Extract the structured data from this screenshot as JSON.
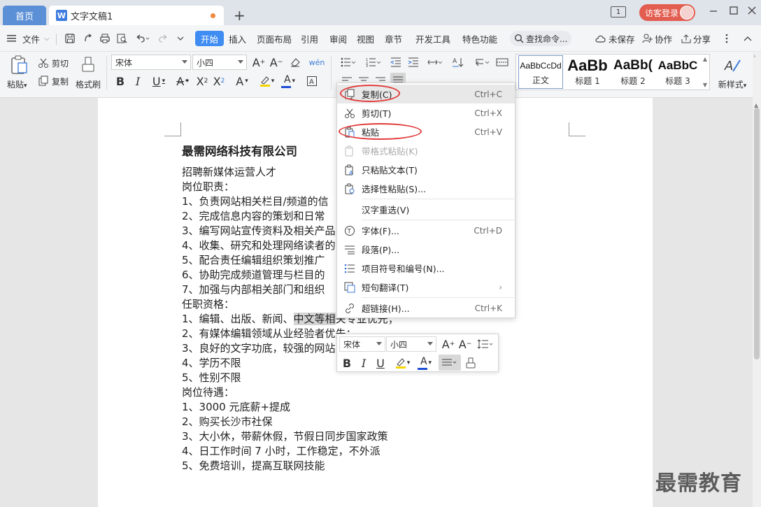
{
  "titlebar": {
    "home_tab": "首页",
    "doc_icon": "W",
    "doc_tab": "文字文稿1",
    "new_tab": "+",
    "window_count": "1",
    "guest_login": "访客登录"
  },
  "menubar": {
    "file": "文件",
    "items": [
      "开始",
      "插入",
      "页面布局",
      "引用",
      "审阅",
      "视图",
      "章节",
      "开发工具",
      "特色功能"
    ],
    "search_placeholder": "查找命令...",
    "unsaved": "未保存",
    "collab": "协作",
    "share": "分享"
  },
  "ribbon": {
    "paste": "粘贴",
    "cut": "剪切",
    "copy": "复制",
    "format_painter": "格式刷",
    "font_name": "宋体",
    "font_size": "小四",
    "styles": [
      {
        "sample": "AaBbCcDd",
        "name": "正文"
      },
      {
        "sample": "AaBb",
        "name": "标题 1"
      },
      {
        "sample": "AaBb(",
        "name": "标题 2"
      },
      {
        "sample": "AaBbC",
        "name": "标题 3"
      }
    ],
    "new_style": "新样式"
  },
  "document": {
    "title": "最需网络科技有限公司",
    "lines": [
      "招聘新媒体运营人才",
      "岗位职责：",
      "1、负责网站相关栏目/频道的信",
      "2、完成信息内容的策划和日常",
      "3、编写网站宣传资料及相关产品",
      "4、收集、研究和处理网络读者的",
      "5、配合责任编辑组织策划推广",
      "6、协助完成频道管理与栏目的",
      "7、加强与内部相关部门和组织",
      "任职资格："
    ],
    "line_11_prefix": "1、编辑、出版、新闻、",
    "line_11_selected": "中文等相",
    "line_11_suffix": "关专业优先；",
    "lines_after": [
      "2、有媒体编辑领域从业经验者优先；",
      "3、良好的文字功底，较强的网站",
      "4、学历不限",
      "5、性别不限",
      "岗位待遇：",
      "1、3000 元底薪+提成",
      "2、购买长沙市社保",
      "3、大小休，带薪休假，节假日同步国家政策",
      "4、日工作时间 7 小时，工作稳定，不外派",
      "5、免费培训，提高互联网技能"
    ]
  },
  "context_menu": {
    "items": [
      {
        "label": "复制(C)",
        "shortcut": "Ctrl+C"
      },
      {
        "label": "剪切(T)",
        "shortcut": "Ctrl+X"
      },
      {
        "label": "粘贴",
        "shortcut": "Ctrl+V"
      },
      {
        "label": "带格式粘贴(K)",
        "shortcut": ""
      },
      {
        "label": "只粘贴文本(T)",
        "shortcut": ""
      },
      {
        "label": "选择性粘贴(S)...",
        "shortcut": ""
      },
      {
        "label": "汉字重选(V)",
        "shortcut": ""
      },
      {
        "label": "字体(F)...",
        "shortcut": "Ctrl+D"
      },
      {
        "label": "段落(P)...",
        "shortcut": ""
      },
      {
        "label": "项目符号和编号(N)...",
        "shortcut": ""
      },
      {
        "label": "短句翻译(T)",
        "shortcut": ""
      },
      {
        "label": "超链接(H)...",
        "shortcut": "Ctrl+K"
      }
    ]
  },
  "mini_toolbar": {
    "font_name": "宋体",
    "font_size": "小四"
  },
  "watermark": "最需教育"
}
